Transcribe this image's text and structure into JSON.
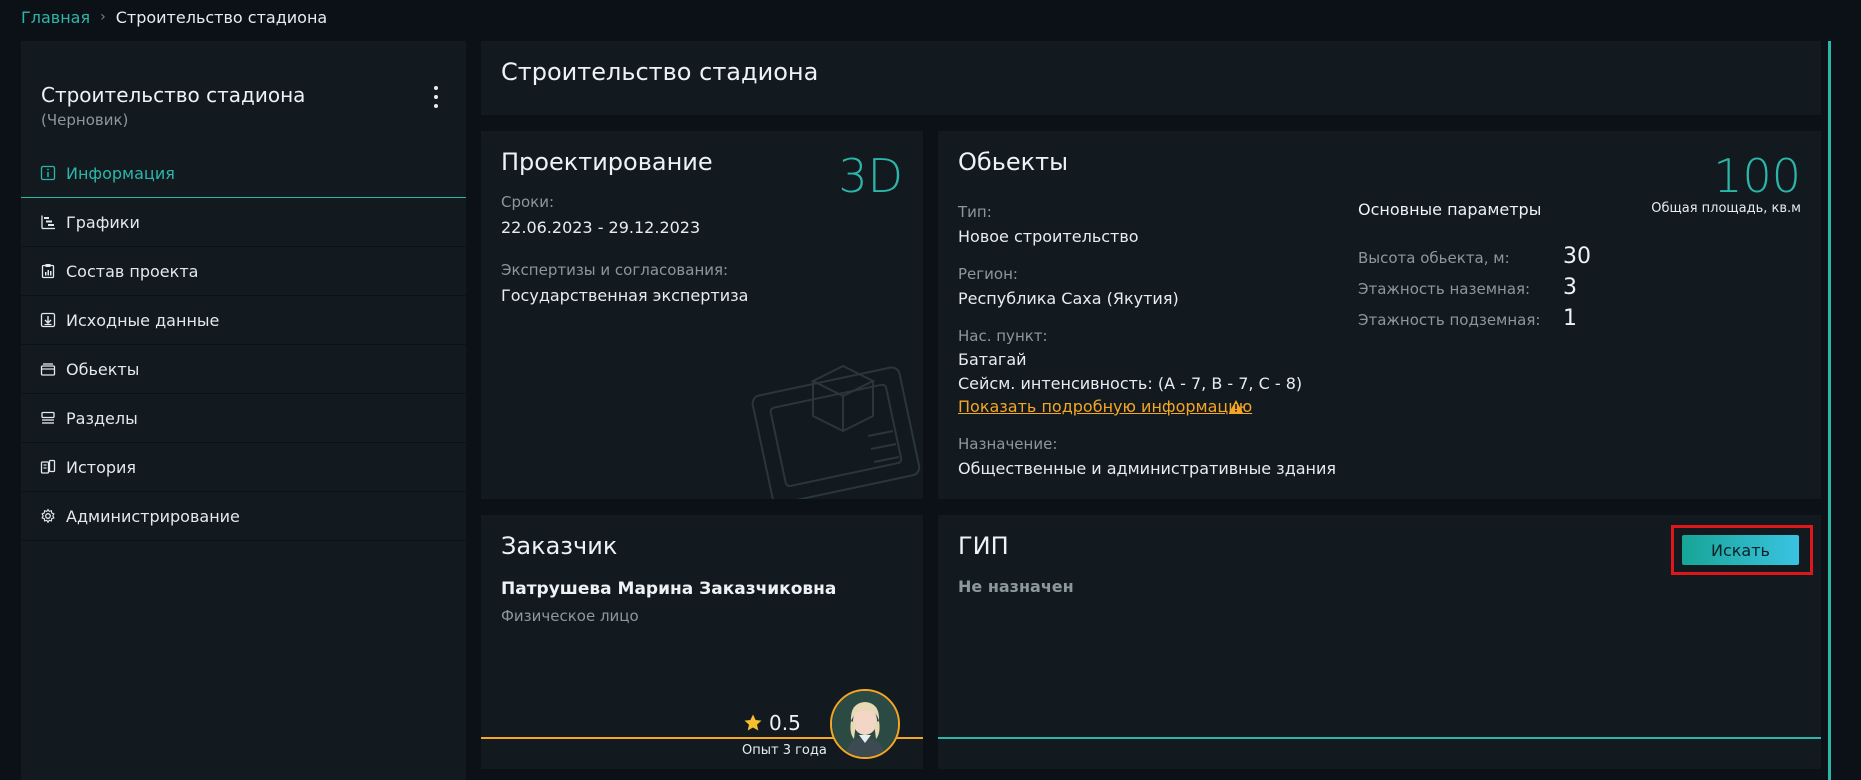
{
  "breadcrumb": {
    "home": "Главная",
    "separator": "›",
    "current": "Строительство стадиона"
  },
  "sidebar": {
    "project_title": "Строительство стадиона",
    "project_status": "(Черновик)",
    "items": [
      {
        "label": "Информация",
        "icon": "info-icon",
        "active": true
      },
      {
        "label": "Графики",
        "icon": "gantt-chart-icon"
      },
      {
        "label": "Состав проекта",
        "icon": "clipboard-chart-icon"
      },
      {
        "label": "Исходные данные",
        "icon": "download-box-icon"
      },
      {
        "label": "Обьекты",
        "icon": "box-icon"
      },
      {
        "label": "Разделы",
        "icon": "sections-icon"
      },
      {
        "label": "История",
        "icon": "history-icon"
      },
      {
        "label": "Администрирование",
        "icon": "gear-icon"
      }
    ]
  },
  "header": {
    "title": "Строительство стадиона"
  },
  "design": {
    "title": "Проектирование",
    "badge": "3D",
    "terms_label": "Сроки:",
    "terms_value": "22.06.2023 - 29.12.2023",
    "expertise_label": "Экспертизы и согласования:",
    "expertise_value": "Государственная экспертиза"
  },
  "objects": {
    "title": "Обьекты",
    "type_label": "Тип:",
    "type_value": "Новое строительство",
    "region_label": "Регион:",
    "region_value": "Республика Саха (Якутия)",
    "settlement_label": "Нас. пункт:",
    "settlement_value": "Батагай",
    "seismic": "Сейсм. интенсивность: (A - 7, B - 7, C - 8)",
    "details_link": "Показать подробную информацию",
    "purpose_label": "Назначение:",
    "purpose_value": "Общественные и административные здания",
    "params_title": "Основные параметры",
    "area_value": "100",
    "area_label": "Общая площадь, кв.м",
    "height_label": "Высота обьекта, м:",
    "height_value": "30",
    "floors_above_label": "Этажность наземная:",
    "floors_above_value": "3",
    "floors_below_label": "Этажность подземная:",
    "floors_below_value": "1"
  },
  "customer": {
    "title": "Заказчик",
    "name": "Патрушева Марина Заказчиковна",
    "type": "Физическое лицо",
    "rating": "0.5",
    "experience": "Опыт 3 года"
  },
  "gip": {
    "title": "ГИП",
    "status": "Не назначен",
    "search_label": "Искать"
  },
  "colors": {
    "accent": "#2cb6a8",
    "warning": "#f5a623",
    "highlight": "#e0161d",
    "background": "#0b1116",
    "card": "#121a20"
  }
}
